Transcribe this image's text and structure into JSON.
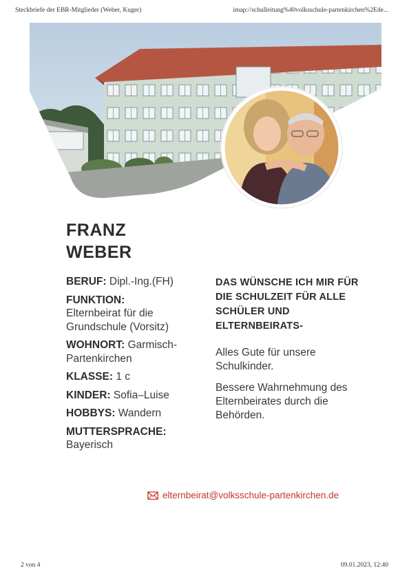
{
  "header": {
    "left": "Steckbriefe der EBR-Mitglieder (Weber, Kuger)",
    "right": "imap://schulleitung%40volksschule-partenkirchen%2Ede..."
  },
  "profile": {
    "first_name": "FRANZ",
    "last_name": "WEBER",
    "fields": [
      {
        "label": "BERUF:",
        "value": "Dipl.-Ing.(FH)"
      },
      {
        "label": "FUNKTION:",
        "value": "Elternbeirat für die Grundschule (Vorsitz)"
      },
      {
        "label": "WOHNORT:",
        "value": "Garmisch-Partenkirchen"
      },
      {
        "label": "KLASSE:",
        "value": "1 c"
      },
      {
        "label": "KINDER:",
        "value": "Sofia–Luise"
      },
      {
        "label": "HOBBYS:",
        "value": "Wandern"
      },
      {
        "label": "MUTTERSPRACHE:",
        "value": "Bayerisch"
      }
    ]
  },
  "wish": {
    "title": "DAS WÜNSCHE ICH MIR FÜR DIE SCHULZEIT FÜR ALLE SCHÜLER UND ELTERNBEIRATS-",
    "paragraphs": [
      "Alles Gute für unsere Schulkinder.",
      "Bessere Wahrnehmung des Elternbeirates durch die Behörden."
    ]
  },
  "contact": {
    "email": "elternbeirat@volksschule-partenkirchen.de",
    "icon": "envelope-icon"
  },
  "footer": {
    "page": "2 von 4",
    "datetime": "09.01.2023, 12:40"
  },
  "colors": {
    "accent": "#c0392b",
    "text": "#2d2d2d"
  }
}
